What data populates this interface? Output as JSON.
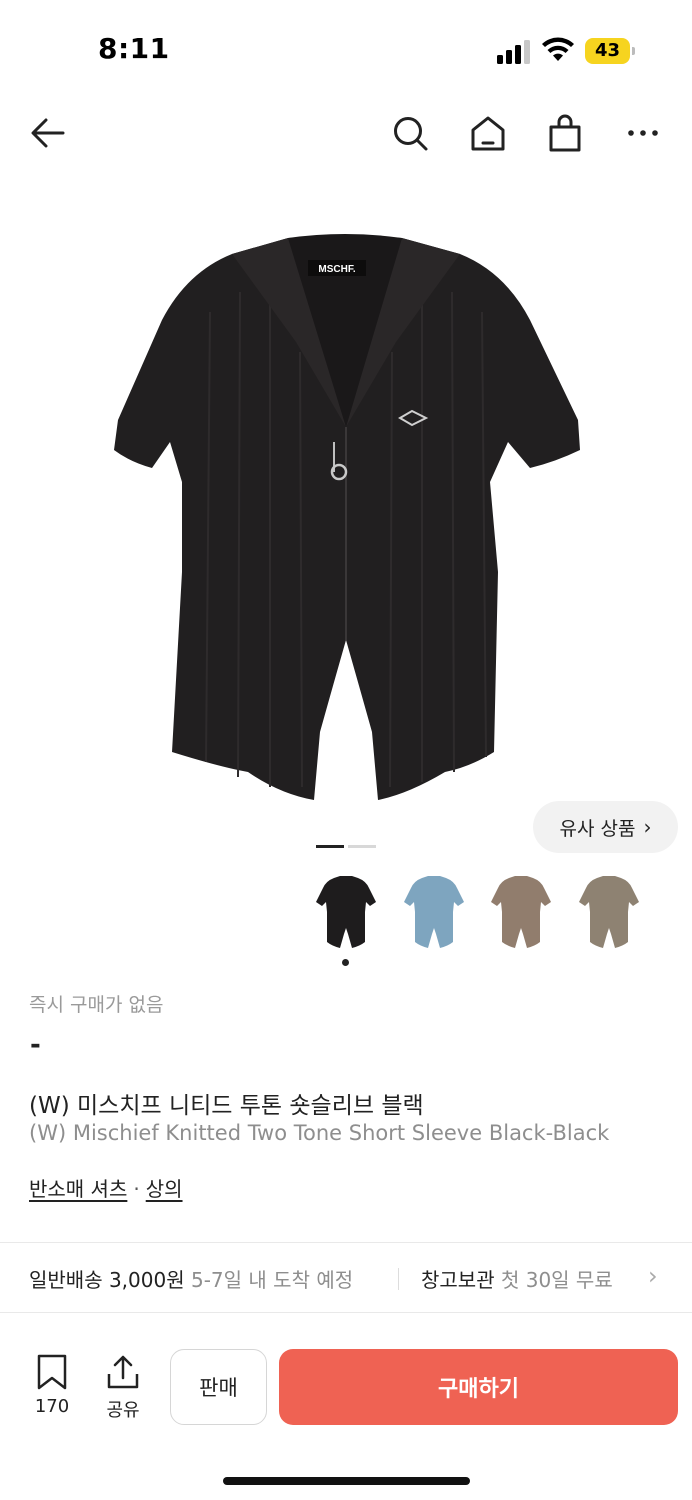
{
  "status_bar": {
    "time": "8:11",
    "battery": "43",
    "icons": [
      "signal-icon",
      "wifi-icon",
      "battery-icon"
    ]
  },
  "nav": {
    "icons": [
      "back-arrow-icon",
      "search-icon",
      "home-icon",
      "shopping-bag-icon",
      "more-icon"
    ]
  },
  "product": {
    "image_logo": "MSCHF.",
    "similar_label": "유사 상품",
    "similar_chevron": "›",
    "pager": {
      "current": 1,
      "total": 2
    },
    "thumbnails": [
      {
        "name": "black",
        "color": "#1e1c1d"
      },
      {
        "name": "blue",
        "color": "#7ea5bf"
      },
      {
        "name": "brown",
        "color": "#917d6d"
      },
      {
        "name": "grey",
        "color": "#8e8272"
      }
    ],
    "selected_thumbnail": 1,
    "instant_purchase": "즉시 구매가 없음",
    "price": "-",
    "title_ko": "(W) 미스치프 니티드 투톤 숏슬리브 블랙",
    "title_en": "(W) Mischief Knitted Two Tone Short Sleeve Black-Black",
    "category_1": "반소매 셔츠",
    "category_sep": "·",
    "category_2": "상의"
  },
  "shipping": {
    "standard_label": "일반배송 3,000원",
    "standard_eta": "5-7일 내 도착 예정",
    "storage_label": "창고보관",
    "storage_offer": "첫 30일 무료",
    "chevron": "›"
  },
  "bottom_bar": {
    "bookmark_count": "170",
    "share_label": "공유",
    "sell_label": "판매",
    "buy_label": "구매하기"
  },
  "colors": {
    "accent": "#ef6253",
    "battery": "#f6d41f",
    "text": "#222222",
    "muted": "#8e8e8e"
  }
}
